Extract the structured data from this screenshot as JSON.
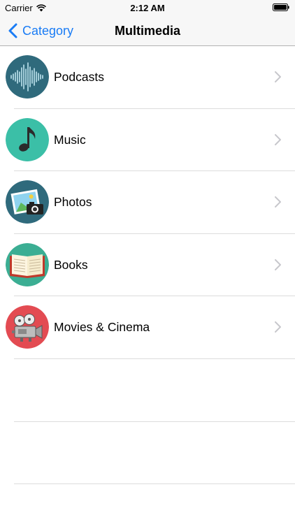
{
  "status_bar": {
    "carrier": "Carrier",
    "time": "2:12 AM"
  },
  "nav": {
    "back_label": "Category",
    "title": "Multimedia"
  },
  "items": [
    {
      "label": "Podcasts",
      "icon": "podcast-waveform-icon",
      "color": "#2f6a7c"
    },
    {
      "label": "Music",
      "icon": "music-note-icon",
      "color": "#3bbfa7"
    },
    {
      "label": "Photos",
      "icon": "photos-camera-icon",
      "color": "#2f6a7c"
    },
    {
      "label": "Books",
      "icon": "open-book-icon",
      "color": "#3bae93"
    },
    {
      "label": "Movies & Cinema",
      "icon": "film-projector-icon",
      "color": "#e34b52"
    }
  ],
  "colors": {
    "accent": "#1a7cf5",
    "separator": "#dcdcdc"
  }
}
